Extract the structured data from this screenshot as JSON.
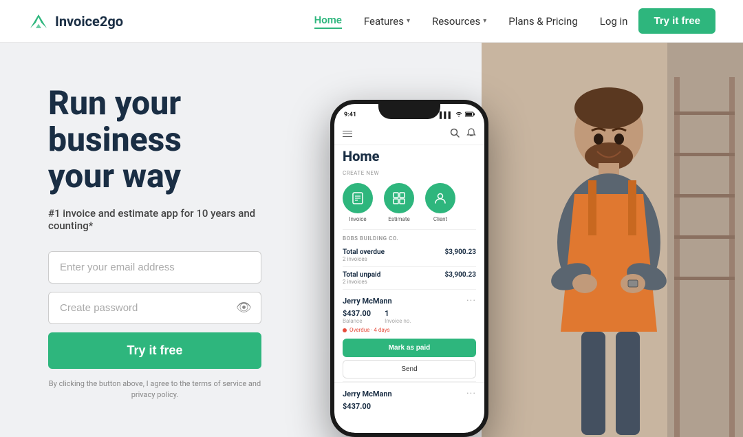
{
  "navbar": {
    "logo_text": "Invoice2go",
    "nav_items": [
      {
        "label": "Home",
        "active": true,
        "has_dropdown": false
      },
      {
        "label": "Features",
        "active": false,
        "has_dropdown": true
      },
      {
        "label": "Resources",
        "active": false,
        "has_dropdown": true
      },
      {
        "label": "Plans & Pricing",
        "active": false,
        "has_dropdown": false
      }
    ],
    "login_label": "Log in",
    "cta_label": "Try it free"
  },
  "hero": {
    "heading_line1": "Run your",
    "heading_line2": "business",
    "heading_line3": "your way",
    "subtext": "#1 invoice and estimate app for 10 years and counting*",
    "email_placeholder": "Enter your email address",
    "password_placeholder": "Create password",
    "cta_label": "Try it free",
    "terms_text": "By clicking the button above, I agree to the terms of service and privacy policy."
  },
  "phone": {
    "time": "9:41",
    "signal_icon": "▌▌▌",
    "wifi_icon": "wifi",
    "battery_icon": "battery",
    "home_title": "Home",
    "create_new_label": "CREATE NEW",
    "create_icons": [
      {
        "label": "Invoice",
        "icon": "☰"
      },
      {
        "label": "Estimate",
        "icon": "⊞"
      },
      {
        "label": "Client",
        "icon": "👤"
      }
    ],
    "section_header": "BOBS BUILDING CO.",
    "summary_rows": [
      {
        "label": "Total overdue",
        "sub": "2 invoices",
        "amount": "$3,900.23"
      },
      {
        "label": "Total unpaid",
        "sub": "2 invoices",
        "amount": "$3,900.23"
      }
    ],
    "client": {
      "name": "Jerry McMann",
      "balance": "$437.00",
      "balance_label": "Balance",
      "invoices": "1",
      "invoices_label": "Invoice no.",
      "overdue_text": "Overdue · 4 days",
      "mark_paid_label": "Mark as paid",
      "send_label": "Send"
    },
    "client2": {
      "name": "Jerry McMann",
      "balance": "$437.00"
    }
  }
}
